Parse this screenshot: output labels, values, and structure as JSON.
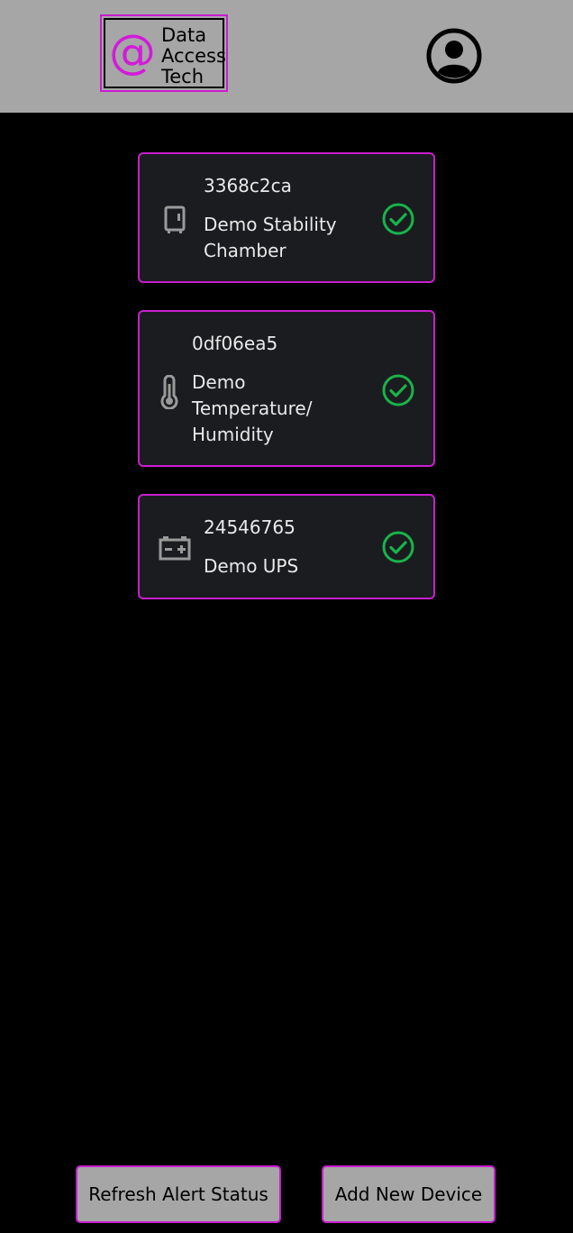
{
  "header": {
    "logo": {
      "at_symbol": "@",
      "lines": [
        "Data",
        "Access",
        "Tech"
      ],
      "accent_color": "#d21bd8"
    },
    "profile_icon": "user-circle-icon"
  },
  "devices": [
    {
      "id": "3368c2ca",
      "name_lines": [
        "Demo Stability",
        "Chamber"
      ],
      "icon": "chamber-icon",
      "status_icon": "check-circle-icon",
      "status_color": "#19b34a"
    },
    {
      "id": "0df06ea5",
      "name_lines": [
        "Demo",
        "Temperature/",
        "Humidity"
      ],
      "icon": "thermometer-icon",
      "status_icon": "check-circle-icon",
      "status_color": "#19b34a"
    },
    {
      "id": "24546765",
      "name_lines": [
        "Demo UPS"
      ],
      "icon": "battery-icon",
      "status_icon": "check-circle-icon",
      "status_color": "#19b34a"
    }
  ],
  "footer": {
    "refresh_label": "Refresh Alert Status",
    "add_label": "Add New Device"
  },
  "colors": {
    "header_bg": "#a6a6a6",
    "card_bg": "#1b1c1f",
    "card_border": "#c81ecf",
    "page_bg": "#000000"
  }
}
